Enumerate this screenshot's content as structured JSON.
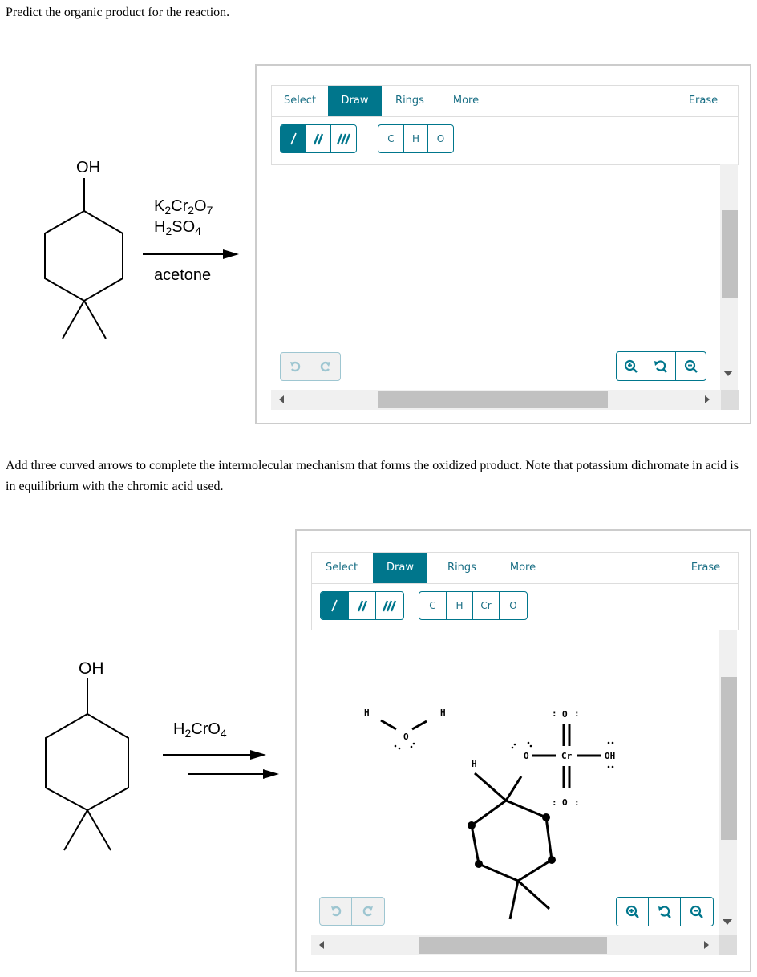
{
  "question1": {
    "prompt": "Predict the organic product for the reaction.",
    "reactant": {
      "substituent_label": "OH"
    },
    "reagents": {
      "line1": {
        "parts": [
          "K",
          "2",
          "Cr",
          "2",
          "O",
          "7"
        ]
      },
      "line2": {
        "parts": [
          "H",
          "2",
          "SO",
          "4"
        ]
      },
      "solvent": "acetone"
    },
    "editor": {
      "tabs": [
        {
          "label": "Select",
          "active": false
        },
        {
          "label": "Draw",
          "active": true
        },
        {
          "label": "Rings",
          "active": false
        },
        {
          "label": "More",
          "active": false
        },
        {
          "label": "Erase",
          "active": false
        }
      ],
      "bond_tools": [
        {
          "name": "single-bond",
          "symbol": "/",
          "active": true
        },
        {
          "name": "double-bond",
          "symbol": "//",
          "active": false
        },
        {
          "name": "triple-bond",
          "symbol": "///",
          "active": false
        }
      ],
      "atom_tools": [
        "C",
        "H",
        "O"
      ],
      "undo_icon": "undo-icon",
      "redo_icon": "redo-icon",
      "zoom_tools": [
        "zoom-in-icon",
        "zoom-reset-icon",
        "zoom-out-icon"
      ]
    }
  },
  "question2": {
    "prompt": "Add three curved arrows to complete the intermolecular mechanism that forms the oxidized product. Note that potassium dichromate in acid is in equilibrium with the chromic acid used.",
    "reactant": {
      "substituent_label": "OH"
    },
    "reagent": {
      "parts": [
        "H",
        "2",
        "CrO",
        "4"
      ]
    },
    "editor": {
      "tabs": [
        {
          "label": "Select",
          "active": false
        },
        {
          "label": "Draw",
          "active": true
        },
        {
          "label": "Rings",
          "active": false
        },
        {
          "label": "More",
          "active": false
        },
        {
          "label": "Erase",
          "active": false
        }
      ],
      "bond_tools": [
        {
          "name": "single-bond",
          "symbol": "/",
          "active": true
        },
        {
          "name": "double-bond",
          "symbol": "//",
          "active": false
        },
        {
          "name": "triple-bond",
          "symbol": "///",
          "active": false
        }
      ],
      "atom_tools": [
        "C",
        "H",
        "Cr",
        "O"
      ],
      "canvas": {
        "water": {
          "h_left": "H",
          "h_right": "H",
          "o": "O",
          "lone_pairs": ":  :"
        },
        "chromate_ester": {
          "ester_o": "O",
          "cr": "Cr",
          "top_o": "O",
          "bottom_o": "O",
          "oh": "OH",
          "alpha_h": "H",
          "lone_pair": ":"
        }
      },
      "undo_icon": "undo-icon",
      "redo_icon": "redo-icon",
      "zoom_tools": [
        "zoom-in-icon",
        "zoom-reset-icon",
        "zoom-out-icon"
      ]
    }
  },
  "colors": {
    "accent": "#00768c",
    "accent_text": "#1a6f85",
    "disabled": "#9ec6d1",
    "scroll_thumb": "#c1c1c1",
    "scroll_track": "#f0f0f0"
  }
}
